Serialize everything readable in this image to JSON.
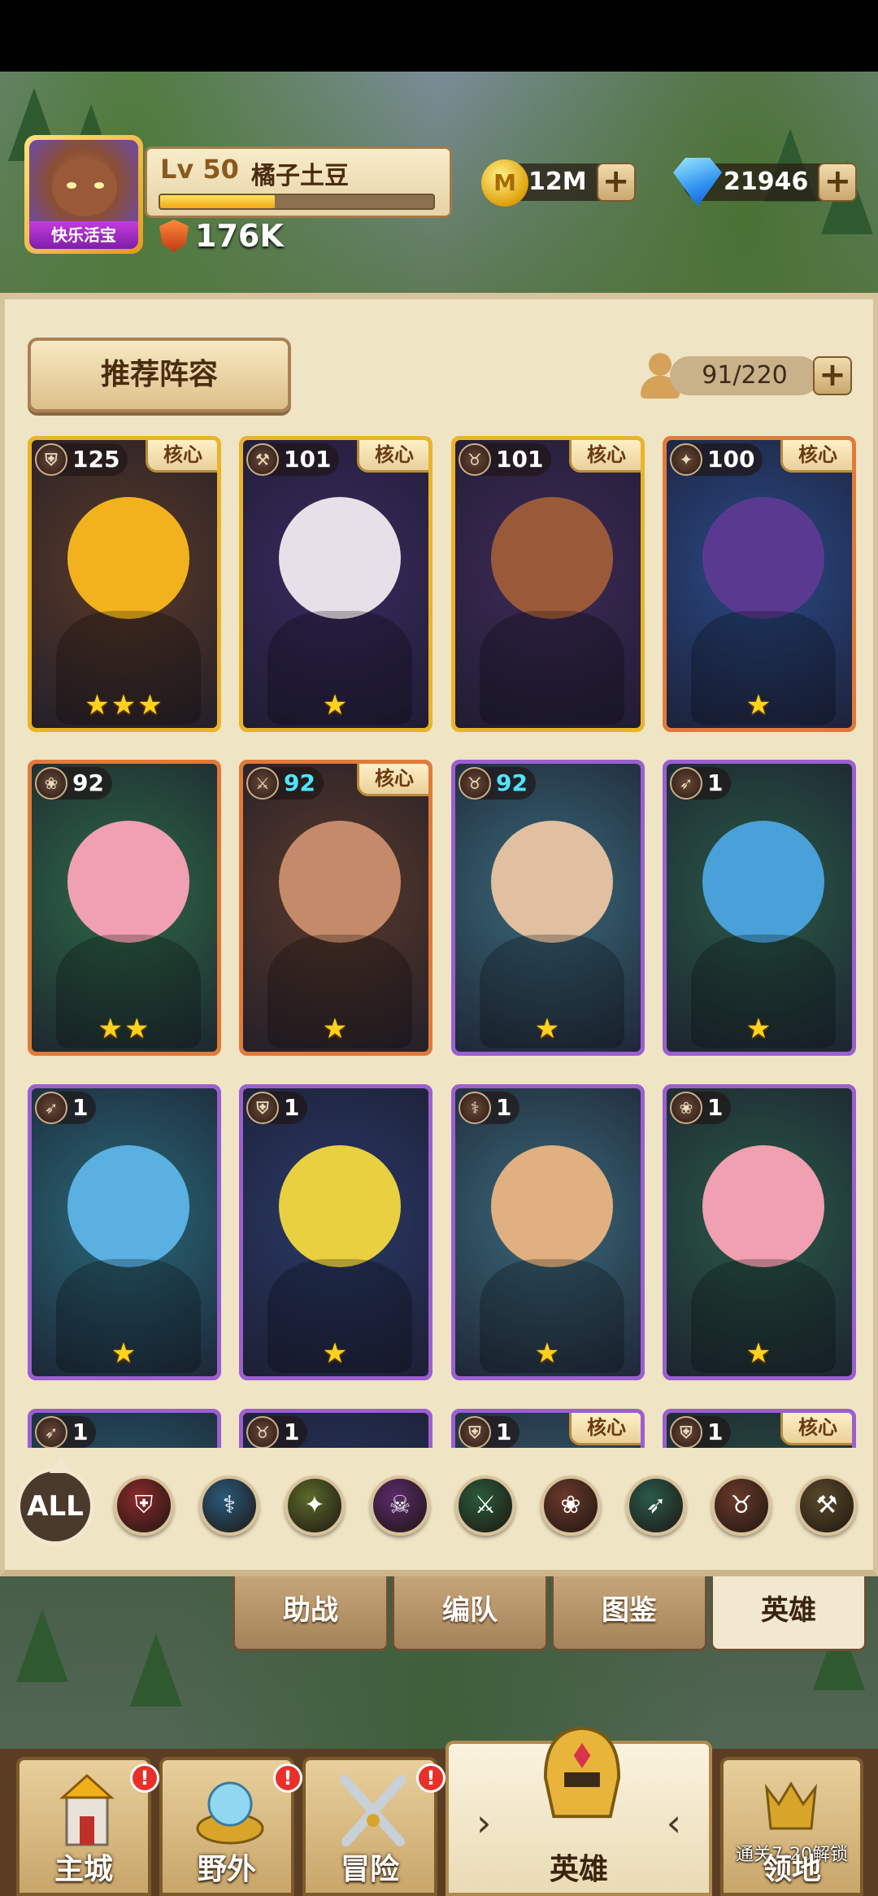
{
  "player": {
    "level": "Lv 50",
    "name": "橘子土豆",
    "avatar_label": "快乐活宝",
    "xp_progress": 0.42,
    "power": "176K"
  },
  "resources": {
    "coins": "12M",
    "coin_symbol": "M",
    "gems": "21946"
  },
  "panel": {
    "recommend_label": "推荐阵容",
    "hero_count": "91/220"
  },
  "heroes": [
    {
      "level": "125",
      "role": "defense-icon",
      "core": "核心",
      "stars": "★★★",
      "frame": "gold"
    },
    {
      "level": "101",
      "role": "axe-icon",
      "core": "核心",
      "stars": "★",
      "frame": "gold"
    },
    {
      "level": "101",
      "role": "bull-skull-icon",
      "core": "核心",
      "stars": "",
      "frame": "gold"
    },
    {
      "level": "100",
      "role": "winged-icon",
      "core": "核心",
      "stars": "★",
      "frame": "orange"
    },
    {
      "level": "92",
      "role": "paw-icon",
      "core": "",
      "stars": "★★",
      "frame": "orange"
    },
    {
      "level": "92",
      "role": "crossed-swords-icon",
      "core": "核心",
      "stars": "★",
      "frame": "orange"
    },
    {
      "level": "92",
      "role": "bull-skull-icon",
      "core": "",
      "stars": "★",
      "frame": "purple"
    },
    {
      "level": "1",
      "role": "bow-icon",
      "core": "",
      "stars": "★",
      "frame": "purple"
    },
    {
      "level": "1",
      "role": "bow-icon",
      "core": "",
      "stars": "★",
      "frame": "purple"
    },
    {
      "level": "1",
      "role": "defense-icon",
      "core": "",
      "stars": "★",
      "frame": "purple"
    },
    {
      "level": "1",
      "role": "staff-icon",
      "core": "",
      "stars": "★",
      "frame": "purple"
    },
    {
      "level": "1",
      "role": "paw-icon",
      "core": "",
      "stars": "★",
      "frame": "purple"
    },
    {
      "level": "1",
      "role": "bow-icon",
      "core": "",
      "stars": "",
      "frame": "purple"
    },
    {
      "level": "1",
      "role": "bull-skull-icon",
      "core": "",
      "stars": "",
      "frame": "purple"
    },
    {
      "level": "1",
      "role": "defense-icon",
      "core": "核心",
      "stars": "",
      "frame": "purple"
    },
    {
      "level": "1",
      "role": "defense-icon",
      "core": "核心",
      "stars": "",
      "frame": "purple"
    }
  ],
  "filters": {
    "all_label": "ALL",
    "items": [
      "shield-icon",
      "staff-icon",
      "winged-icon",
      "skull-icon",
      "crossed-swords-icon",
      "paw-icon",
      "bow-icon",
      "bull-skull-icon",
      "hammer-icon"
    ]
  },
  "subtabs": [
    "助战",
    "编队",
    "图鉴",
    "英雄"
  ],
  "nav": {
    "items": [
      "主城",
      "野外",
      "冒险",
      "英雄",
      "领地"
    ],
    "alert": "!",
    "unlock_text": "通关7-20解锁"
  }
}
